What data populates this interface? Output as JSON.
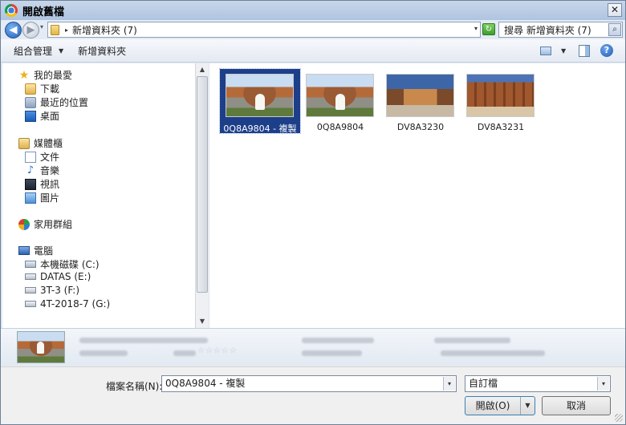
{
  "window": {
    "title": "開啟舊檔",
    "close_glyph": "✕"
  },
  "nav": {
    "back_glyph": "◀",
    "forward_glyph": "▶",
    "history_glyph": "▾",
    "breadcrumb_separator": "▸",
    "breadcrumb": "新增資料夾 (7)",
    "address_dropdown_glyph": "▾",
    "refresh_glyph": "↻",
    "search_placeholder": "搜尋 新增資料夾 (7)",
    "search_glyph": "⌕"
  },
  "toolbar": {
    "organize": "組合管理",
    "organize_caret": "▼",
    "new_folder": "新增資料夾",
    "view_caret": "▼",
    "help_glyph": "?"
  },
  "sidebar": {
    "favorites": {
      "label": "我的最愛",
      "icon": "star-icon",
      "glyph": "★"
    },
    "fav_items": [
      {
        "label": "下載",
        "icon": "downloads-folder-icon"
      },
      {
        "label": "最近的位置",
        "icon": "recent-places-icon"
      },
      {
        "label": "桌面",
        "icon": "desktop-icon"
      }
    ],
    "libraries": {
      "label": "媒體櫃",
      "icon": "library-icon"
    },
    "lib_items": [
      {
        "label": "文件",
        "icon": "documents-icon"
      },
      {
        "label": "音樂",
        "icon": "music-icon",
        "glyph": "♪"
      },
      {
        "label": "視訊",
        "icon": "video-icon"
      },
      {
        "label": "圖片",
        "icon": "pictures-icon"
      }
    ],
    "homegroup": {
      "label": "家用群組",
      "icon": "homegroup-icon"
    },
    "computer": {
      "label": "電腦",
      "icon": "computer-icon"
    },
    "drives": [
      {
        "label": "本機磁碟 (C:)",
        "icon": "system-drive-icon"
      },
      {
        "label": "DATAS (E:)",
        "icon": "drive-icon"
      },
      {
        "label": "3T-3 (F:)",
        "icon": "drive-icon"
      },
      {
        "label": "4T-2018-7 (G:)",
        "icon": "drive-icon"
      }
    ],
    "scroll_up_glyph": "▲",
    "scroll_down_glyph": "▼"
  },
  "files": [
    {
      "name": "0Q8A9804 - 複製",
      "selected": true
    },
    {
      "name": "0Q8A9804",
      "selected": false
    },
    {
      "name": "DV8A3230",
      "selected": false
    },
    {
      "name": "DV8A3231",
      "selected": false
    }
  ],
  "details": {
    "rating_stars": "☆☆☆☆☆"
  },
  "bottom": {
    "filename_label": "檔案名稱(N):",
    "filename_value": "0Q8A9804 - 複製",
    "dropdown_glyph": "▾",
    "filetype": "自訂檔",
    "open_label": "開啟(O)",
    "open_split_glyph": "▼",
    "cancel_label": "取消"
  },
  "colors": {
    "selection": "#1d3f8a",
    "titlebar": "#b9cde6",
    "accent": "#3c7fb1"
  }
}
